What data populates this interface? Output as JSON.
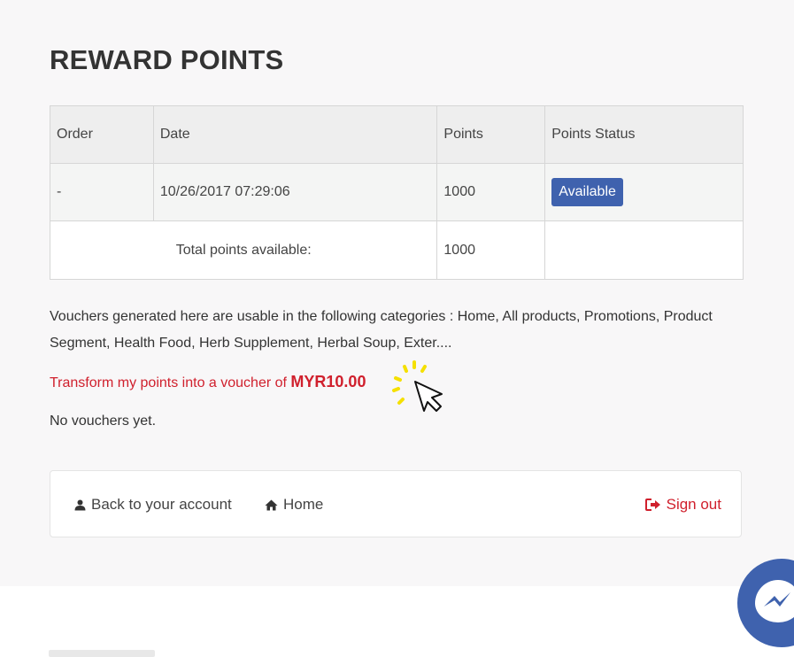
{
  "page": {
    "title": "REWARD POINTS"
  },
  "table": {
    "headers": [
      "Order",
      "Date",
      "Points",
      "Points Status"
    ],
    "rows": [
      {
        "order": "-",
        "date": "10/26/2017 07:29:06",
        "points": "1000",
        "status": "Available"
      }
    ],
    "total": {
      "label": "Total points available:",
      "points": "1000"
    }
  },
  "info": {
    "vouchers_description": "Vouchers generated here are usable in the following categories : Home, All products, Promotions, Product Segment, Health Food, Herb Supplement, Herbal Soup, Exter....",
    "transform_text": "Transform my points into a voucher of ",
    "transform_amount": "MYR10.00",
    "no_vouchers": "No vouchers yet."
  },
  "footer": {
    "back_label": "Back to your account",
    "home_label": "Home",
    "signout_label": "Sign out"
  },
  "icons": {
    "back": "user-icon",
    "home": "home-icon",
    "signout": "sign-out-icon",
    "cursor": "pointer-cursor-icon",
    "chat": "messenger-icon"
  },
  "colors": {
    "badge": "#3f62ae",
    "accent_red": "#d0202d",
    "panel_bg": "#f8f7f8"
  }
}
